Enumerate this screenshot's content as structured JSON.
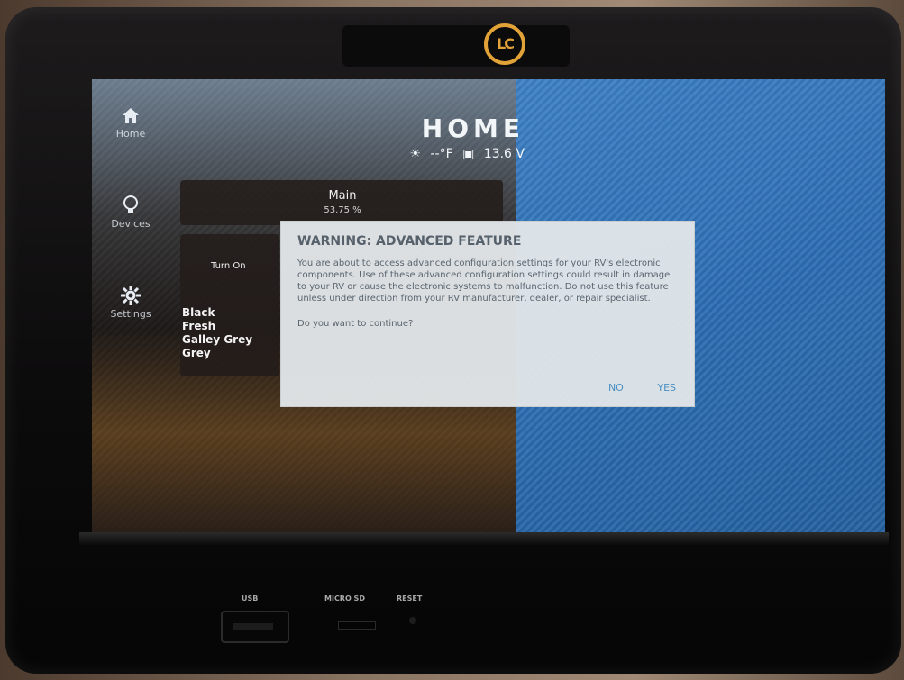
{
  "device": {
    "brand_icon": "lci-logo"
  },
  "nav": {
    "items": [
      {
        "label": "Home",
        "icon": "home-icon"
      },
      {
        "label": "Devices",
        "icon": "lightbulb-icon"
      },
      {
        "label": "Settings",
        "icon": "gear-icon"
      }
    ]
  },
  "header": {
    "title": "HOME",
    "temperature": "--°F",
    "battery": "13.6 V"
  },
  "main_tank": {
    "name": "Main",
    "value": "53.75 %"
  },
  "lights": {
    "turn_on": "Turn On"
  },
  "tanks_list": [
    "Black",
    "Fresh",
    "Galley Grey",
    "Grey"
  ],
  "dialog": {
    "title": "WARNING: ADVANCED FEATURE",
    "body": "You are about to access advanced configuration settings for your RV's electronic components. Use of these advanced configuration settings could result in damage to your RV or cause the electronic systems to malfunction. Do not use this feature unless under direction from your RV manufacturer, dealer, or repair specialist.",
    "question": "Do you want to continue?",
    "no_label": "NO",
    "yes_label": "YES"
  },
  "ports": {
    "usb": "USB",
    "microsd": "MICRO SD",
    "reset": "RESET"
  },
  "colors": {
    "accent": "#e1a238",
    "dialog_bg": "#e2e6e8",
    "dialog_button": "#4a8fc4",
    "screen_blue": "#2c6db3"
  }
}
